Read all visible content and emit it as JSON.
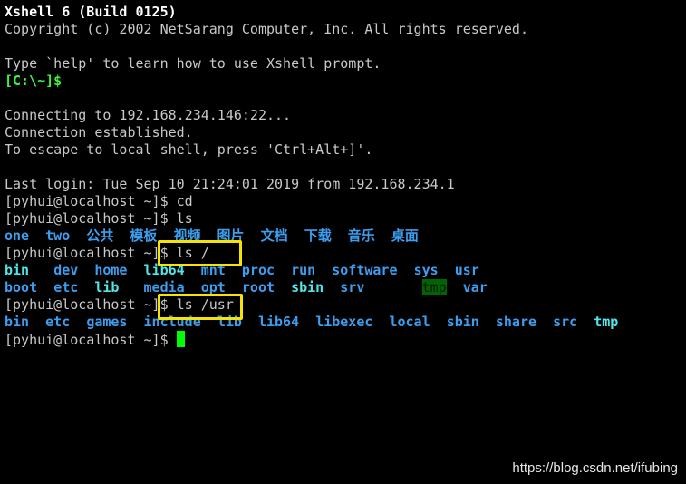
{
  "terminal": {
    "lines": [
      [
        {
          "t": "Xshell 6 (Build 0125)",
          "c": "h"
        }
      ],
      [
        {
          "t": "Copyright (c) 2002 NetSarang Computer, Inc. All rights reserved.",
          "c": ""
        }
      ],
      [],
      [
        {
          "t": "Type `help' to learn how to use Xshell prompt.",
          "c": ""
        }
      ],
      [
        {
          "t": "[C:\\~]$",
          "c": "g"
        }
      ],
      [],
      [
        {
          "t": "Connecting to 192.168.234.146:22...",
          "c": ""
        }
      ],
      [
        {
          "t": "Connection established.",
          "c": ""
        }
      ],
      [
        {
          "t": "To escape to local shell, press 'Ctrl+Alt+]'.",
          "c": ""
        }
      ],
      [],
      [
        {
          "t": "Last login: Tue Sep 10 21:24:01 2019 from 192.168.234.1",
          "c": ""
        }
      ],
      [
        {
          "t": "[pyhui@localhost ~]$ cd",
          "c": ""
        }
      ],
      [
        {
          "t": "[pyhui@localhost ~]$ ls",
          "c": ""
        }
      ],
      [
        {
          "t": "one",
          "c": "d"
        },
        {
          "t": "  ",
          "c": ""
        },
        {
          "t": "two",
          "c": "d"
        },
        {
          "t": "  ",
          "c": ""
        },
        {
          "t": "公共",
          "c": "d"
        },
        {
          "t": "  ",
          "c": ""
        },
        {
          "t": "模板",
          "c": "d"
        },
        {
          "t": "  ",
          "c": ""
        },
        {
          "t": "视频",
          "c": "d"
        },
        {
          "t": "  ",
          "c": ""
        },
        {
          "t": "图片",
          "c": "d"
        },
        {
          "t": "  ",
          "c": ""
        },
        {
          "t": "文档",
          "c": "d"
        },
        {
          "t": "  ",
          "c": ""
        },
        {
          "t": "下载",
          "c": "d"
        },
        {
          "t": "  ",
          "c": ""
        },
        {
          "t": "音乐",
          "c": "d"
        },
        {
          "t": "  ",
          "c": ""
        },
        {
          "t": "桌面",
          "c": "d"
        }
      ],
      [
        {
          "t": "[pyhui@localhost ~]$ ls /",
          "c": ""
        }
      ],
      [
        {
          "t": "bin",
          "c": "l"
        },
        {
          "t": "   ",
          "c": ""
        },
        {
          "t": "dev",
          "c": "d"
        },
        {
          "t": "  ",
          "c": ""
        },
        {
          "t": "home",
          "c": "d"
        },
        {
          "t": "  ",
          "c": ""
        },
        {
          "t": "lib64",
          "c": "l"
        },
        {
          "t": "  ",
          "c": ""
        },
        {
          "t": "mnt",
          "c": "d"
        },
        {
          "t": "  ",
          "c": ""
        },
        {
          "t": "proc",
          "c": "d"
        },
        {
          "t": "  ",
          "c": ""
        },
        {
          "t": "run",
          "c": "d"
        },
        {
          "t": "  ",
          "c": ""
        },
        {
          "t": "software",
          "c": "d"
        },
        {
          "t": "  ",
          "c": ""
        },
        {
          "t": "sys",
          "c": "d"
        },
        {
          "t": "  ",
          "c": ""
        },
        {
          "t": "usr",
          "c": "d"
        }
      ],
      [
        {
          "t": "boot",
          "c": "d"
        },
        {
          "t": "  ",
          "c": ""
        },
        {
          "t": "etc",
          "c": "d"
        },
        {
          "t": "  ",
          "c": ""
        },
        {
          "t": "lib",
          "c": "l"
        },
        {
          "t": "   ",
          "c": ""
        },
        {
          "t": "media",
          "c": "d"
        },
        {
          "t": "  ",
          "c": ""
        },
        {
          "t": "opt",
          "c": "d"
        },
        {
          "t": "  ",
          "c": ""
        },
        {
          "t": "root",
          "c": "d"
        },
        {
          "t": "  ",
          "c": ""
        },
        {
          "t": "sbin",
          "c": "l"
        },
        {
          "t": "  ",
          "c": ""
        },
        {
          "t": "srv",
          "c": "d"
        },
        {
          "t": "       ",
          "c": ""
        },
        {
          "t": "tmp",
          "c": "t"
        },
        {
          "t": "  ",
          "c": ""
        },
        {
          "t": "var",
          "c": "d"
        }
      ],
      [
        {
          "t": "[pyhui@localhost ~]$ ls /usr",
          "c": ""
        }
      ],
      [
        {
          "t": "bin",
          "c": "d"
        },
        {
          "t": "  ",
          "c": ""
        },
        {
          "t": "etc",
          "c": "d"
        },
        {
          "t": "  ",
          "c": ""
        },
        {
          "t": "games",
          "c": "d"
        },
        {
          "t": "  ",
          "c": ""
        },
        {
          "t": "include",
          "c": "d"
        },
        {
          "t": "  ",
          "c": ""
        },
        {
          "t": "lib",
          "c": "d"
        },
        {
          "t": "  ",
          "c": ""
        },
        {
          "t": "lib64",
          "c": "d"
        },
        {
          "t": "  ",
          "c": ""
        },
        {
          "t": "libexec",
          "c": "d"
        },
        {
          "t": "  ",
          "c": ""
        },
        {
          "t": "local",
          "c": "d"
        },
        {
          "t": "  ",
          "c": ""
        },
        {
          "t": "sbin",
          "c": "d"
        },
        {
          "t": "  ",
          "c": ""
        },
        {
          "t": "share",
          "c": "d"
        },
        {
          "t": "  ",
          "c": ""
        },
        {
          "t": "src",
          "c": "d"
        },
        {
          "t": "  ",
          "c": ""
        },
        {
          "t": "tmp",
          "c": "l"
        }
      ],
      [
        {
          "t": "[pyhui@localhost ~]$ ",
          "c": ""
        }
      ]
    ]
  },
  "colors": {
    "directory": "#3c9ef0",
    "symlink": "#4fe6e6",
    "prompt_local": "#3ff03f",
    "cursor": "#00ff00",
    "highlight_box": "#f5e400",
    "sticky_dir_bg": "#006400"
  },
  "watermark": "https://blog.csdn.net/ifubing"
}
